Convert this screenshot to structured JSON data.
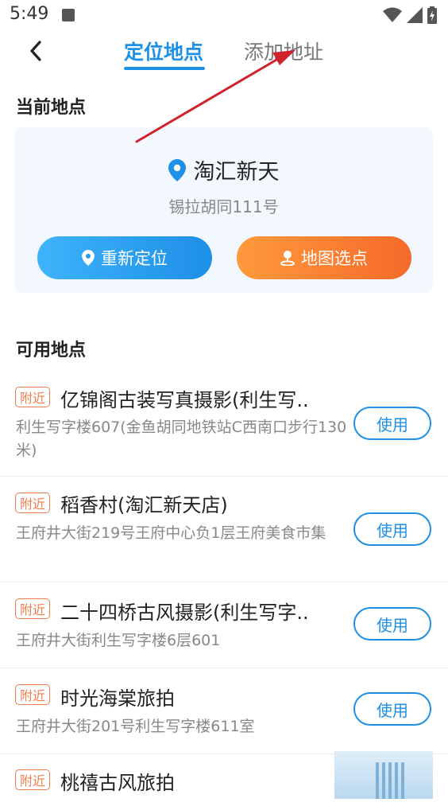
{
  "status": {
    "time": "5:49"
  },
  "nav": {
    "tabs": [
      {
        "label": "定位地点",
        "active": true
      },
      {
        "label": "添加地址",
        "active": false
      }
    ]
  },
  "current": {
    "section_title": "当前地点",
    "place_name": "淘汇新天",
    "address": "锡拉胡同111号",
    "relocate_label": "重新定位",
    "map_pick_label": "地图选点"
  },
  "available": {
    "section_title": "可用地点",
    "items": [
      {
        "badge": "附近",
        "name": "亿锦阁古装写真摄影(利生写..",
        "address": "利生写字楼607(金鱼胡同地铁站C西南口步行130米)",
        "button": "使用"
      },
      {
        "badge": "附近",
        "name": "稻香村(淘汇新天店)",
        "address": "王府井大街219号王府中心负1层王府美食市集",
        "button": "使用"
      },
      {
        "badge": "附近",
        "name": "二十四桥古风摄影(利生写字..",
        "address": "王府井大街利生写字楼6层601",
        "button": "使用"
      },
      {
        "badge": "附近",
        "name": "时光海棠旅拍",
        "address": "王府井大街201号利生写字楼611室",
        "button": "使用"
      },
      {
        "badge": "附近",
        "name": "桃禧古风旅拍",
        "address": "",
        "button": ""
      }
    ]
  },
  "colors": {
    "accent": "#1e90e6",
    "orange": "#f56a2a",
    "badge": "#f07c4e",
    "annotation_arrow": "#d0222a"
  }
}
